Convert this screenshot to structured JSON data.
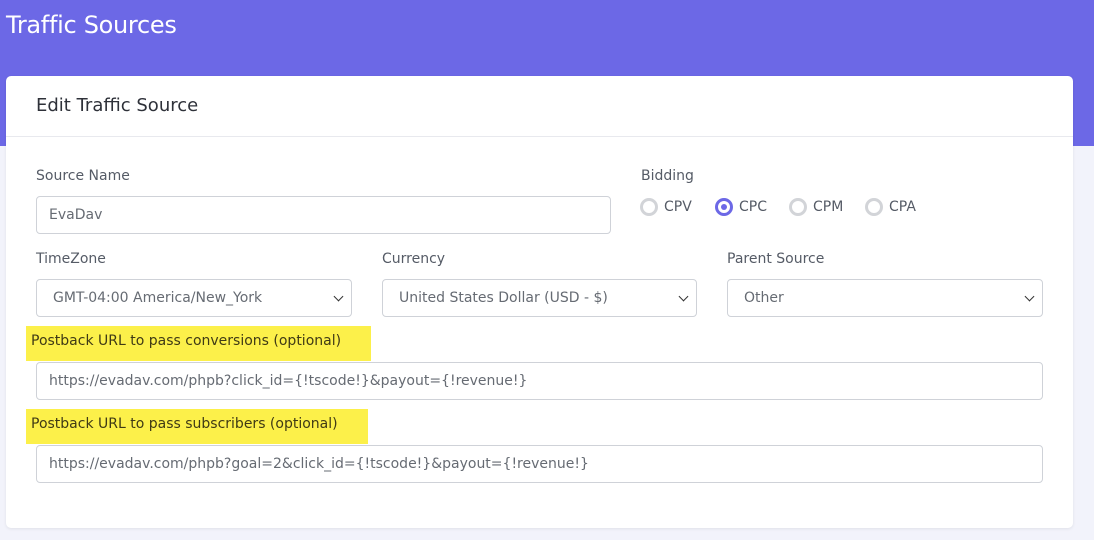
{
  "page": {
    "title": "Traffic Sources"
  },
  "card": {
    "title": "Edit Traffic Source"
  },
  "form": {
    "source_name": {
      "label": "Source Name",
      "value": "EvaDav"
    },
    "bidding": {
      "label": "Bidding",
      "options": [
        "CPV",
        "CPC",
        "CPM",
        "CPA"
      ],
      "selected": "CPC"
    },
    "timezone": {
      "label": "TimeZone",
      "value": "GMT-04:00 America/New_York"
    },
    "currency": {
      "label": "Currency",
      "value": "United States Dollar (USD - $)"
    },
    "parent_source": {
      "label": "Parent Source",
      "value": "Other"
    },
    "postback_conversions": {
      "label": "Postback URL to pass conversions (optional)",
      "value": "https://evadav.com/phpb?click_id={!tscode!}&payout={!revenue!}"
    },
    "postback_subscribers": {
      "label": "Postback URL to pass subscribers (optional)",
      "value": "https://evadav.com/phpb?goal=2&click_id={!tscode!}&payout={!revenue!}"
    }
  },
  "colors": {
    "banner": "#6c68e6",
    "accent": "#6c68e6",
    "highlight": "#fcf04a",
    "background": "#f2f3fb"
  }
}
